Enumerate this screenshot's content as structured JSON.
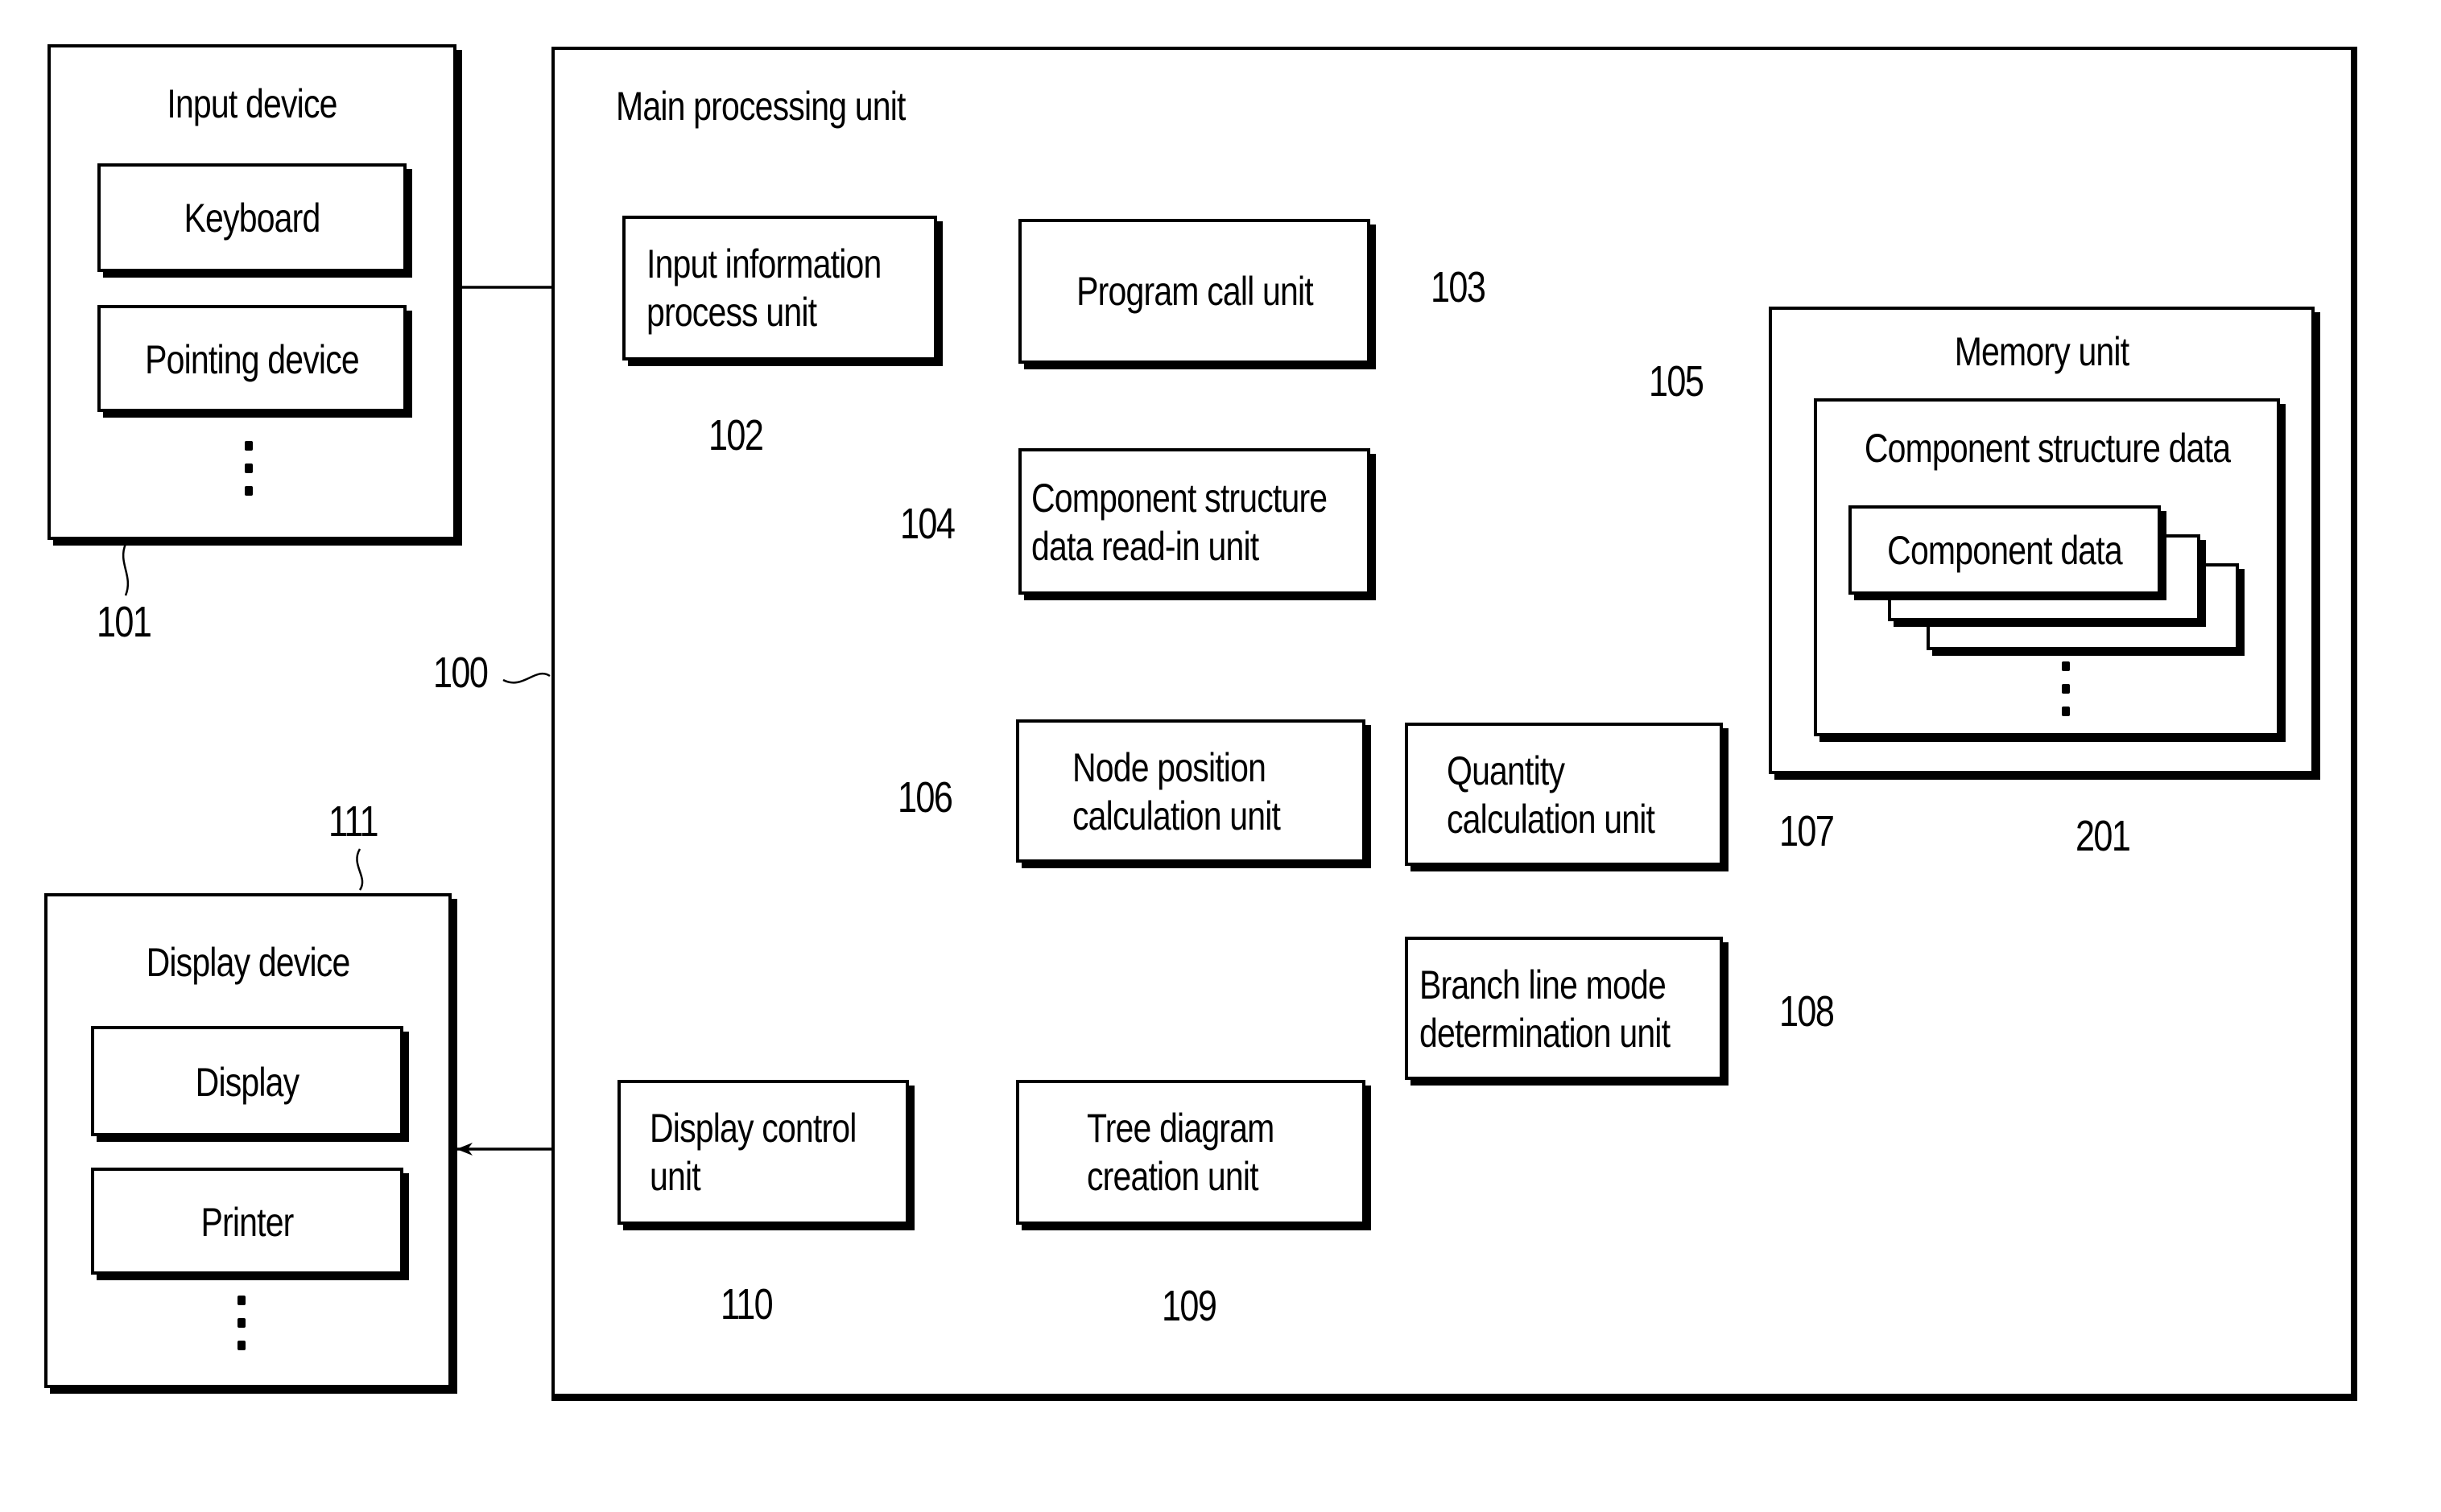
{
  "input_device": {
    "title": "Input device",
    "items": [
      "Keyboard",
      "Pointing device"
    ],
    "ref": "101"
  },
  "main_unit": {
    "title": "Main processing unit",
    "ref": "100"
  },
  "units": {
    "input_info": {
      "line1": "Input information",
      "line2": "process unit",
      "ref": "102"
    },
    "program_call": {
      "line1": "Program call unit",
      "ref": "103"
    },
    "read_in": {
      "line1": "Component structure",
      "line2": "data read-in unit",
      "ref": "104"
    },
    "node_position": {
      "line1": "Node position",
      "line2": "calculation unit",
      "ref": "106"
    },
    "quantity": {
      "line1": "Quantity",
      "line2": "calculation unit",
      "ref": "107"
    },
    "branch_line": {
      "line1": "Branch line mode",
      "line2": "determination unit",
      "ref": "108"
    },
    "tree_diagram": {
      "line1": "Tree diagram",
      "line2": "creation unit",
      "ref": "109"
    },
    "display_control": {
      "line1": "Display control",
      "line2": "unit",
      "ref": "110"
    }
  },
  "memory_unit": {
    "title": "Memory unit",
    "ref": "105",
    "structure_data": {
      "title": "Component structure data",
      "item": "Component data",
      "ref": "201"
    }
  },
  "display_device": {
    "title": "Display device",
    "items": [
      "Display",
      "Printer"
    ],
    "ref": "111"
  }
}
